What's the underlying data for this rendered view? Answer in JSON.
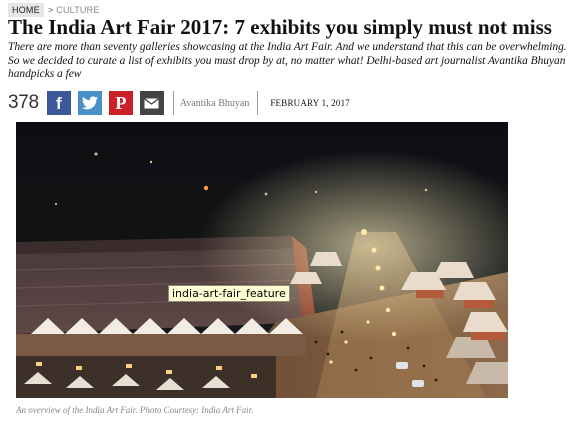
{
  "breadcrumb": {
    "home": "HOME",
    "separator": ">",
    "section": "CULTURE"
  },
  "article": {
    "title": "The India Art Fair 2017: 7 exhibits you simply must not miss",
    "subtitle": "There are more than seventy galleries showcasing at the India Art Fair. And we understand that this can be overwhelming. So we decided to curate a list of exhibits you must drop by at, no matter what! Delhi-based art journalist Avantika Bhuyan handpicks a few",
    "author": "Avantika Bhuyan",
    "date": "FEBRUARY 1, 2017"
  },
  "share": {
    "count": "378",
    "buttons": [
      {
        "network": "facebook",
        "icon": "facebook-icon",
        "color": "#3b5998"
      },
      {
        "network": "twitter",
        "icon": "twitter-icon",
        "color": "#4a90c8"
      },
      {
        "network": "pinterest",
        "icon": "pinterest-icon",
        "color": "#cb2027"
      },
      {
        "network": "email",
        "icon": "envelope-icon",
        "color": "#444444"
      }
    ]
  },
  "image": {
    "tooltip": "india-art-fair_feature",
    "caption": "An overview of the India Art Fair. Photo Courtesy: India Art Fair."
  }
}
